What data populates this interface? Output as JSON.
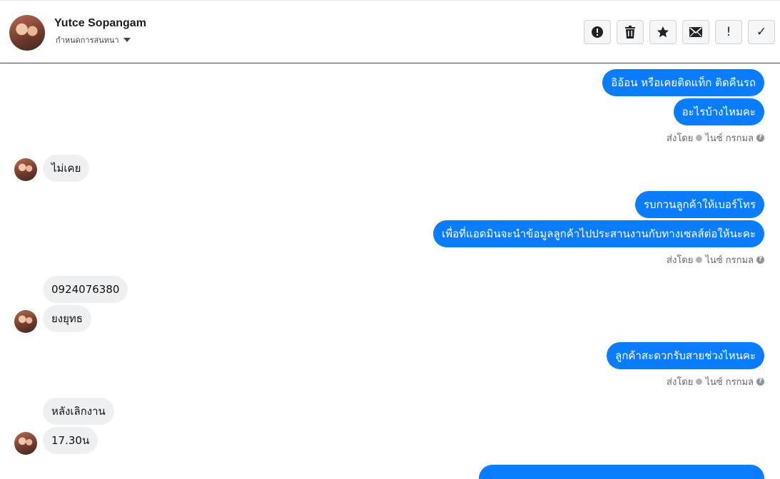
{
  "header": {
    "name": "Yutce Sopangam",
    "subtitle": "กำหนดการสนทนา",
    "actions": [
      {
        "icon": "alert-circle-icon"
      },
      {
        "icon": "trash-icon"
      },
      {
        "icon": "star-icon"
      },
      {
        "icon": "envelope-icon"
      },
      {
        "label": "!",
        "icon": "exclamation-icon"
      },
      {
        "label": "✓",
        "icon": "check-icon"
      }
    ]
  },
  "messages": [
    {
      "dir": "out",
      "text": "อิอ้อน หรือเคยติดแท็ก ติดคืนรถ"
    },
    {
      "dir": "out",
      "text": "อะไรบ้างไหมคะ"
    },
    {
      "meta": "ส่งโดย",
      "sender": "ไนซ์ กรกมล"
    },
    {
      "dir": "in",
      "text": "ไม่เคย"
    },
    {
      "dir": "out",
      "text": "รบกวนลูกค้าให้เบอร์โทร"
    },
    {
      "dir": "out",
      "text": "เพื่อที่แอดมินจะนำข้อมูลลูกค้าไปประสานงานกับทางเซลส์ต่อให้นะคะ"
    },
    {
      "meta": "ส่งโดย",
      "sender": "ไนซ์ กรกมล"
    },
    {
      "dir": "in",
      "text": "0924076380"
    },
    {
      "dir": "in",
      "text": "ยงยุทธ"
    },
    {
      "dir": "out",
      "text": "ลูกค้าสะดวกรับสายช่วงไหนคะ"
    },
    {
      "meta": "ส่งโดย",
      "sender": "ไนซ์ กรกมล"
    },
    {
      "dir": "in",
      "text": "หลังเลิกงาน"
    },
    {
      "dir": "in",
      "text": "17.30น"
    }
  ],
  "colors": {
    "outgoing": "#0a7cff",
    "incoming": "#eff0f2"
  }
}
